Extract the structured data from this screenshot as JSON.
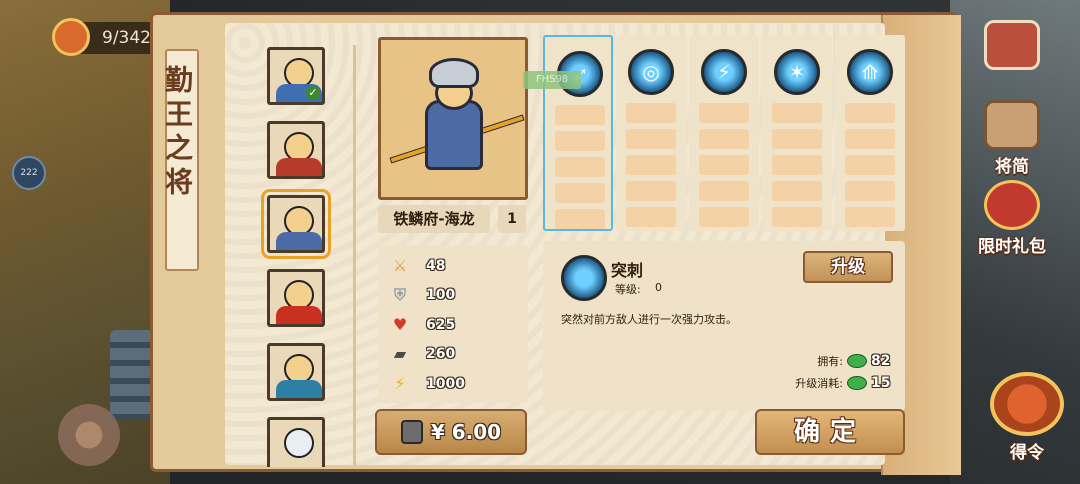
{
  "hud": {
    "counter": "9/342",
    "side_dot": "222"
  },
  "right_menu": {
    "book_label": "将简",
    "gift_label": "限时礼包",
    "order_label": "得令"
  },
  "panel": {
    "title": "勤王之将"
  },
  "hero": {
    "name": "铁鳞府-海龙",
    "level": "1"
  },
  "stats": [
    {
      "icon": "sword-icon",
      "value": "48",
      "color": "#e2a33a"
    },
    {
      "icon": "shield-icon",
      "value": "100",
      "color": "#9aa2a8"
    },
    {
      "icon": "heart-icon",
      "value": "625",
      "color": "#d23a2a"
    },
    {
      "icon": "boot-icon",
      "value": "260",
      "color": "#4a4a4a"
    },
    {
      "icon": "lightning-icon",
      "value": "1000",
      "color": "#f2b21a"
    }
  ],
  "buy": {
    "price": "¥ 6.00"
  },
  "skills": {
    "cost_tag": "FHS98",
    "columns": [
      {
        "icon": "spear-thrust-icon",
        "selected": true
      },
      {
        "icon": "whirlwind-icon",
        "selected": false
      },
      {
        "icon": "lightning-slash-icon",
        "selected": false
      },
      {
        "icon": "multi-strike-icon",
        "selected": false
      },
      {
        "icon": "triple-spear-icon",
        "selected": false
      }
    ]
  },
  "skill_detail": {
    "name": "突刺",
    "level_label": "等级:",
    "level_value": "0",
    "description": "突然对前方敌人进行一次强力攻击。",
    "upgrade_label": "升级",
    "owned_label": "拥有:",
    "owned_value": "82",
    "cost_label": "升级消耗:",
    "cost_value": "15"
  },
  "confirm_label": "确定",
  "colors": {
    "accent_orange": "#e8a326",
    "selected_blue": "#5bb6e8",
    "panel_beige": "#f3e8d2"
  }
}
